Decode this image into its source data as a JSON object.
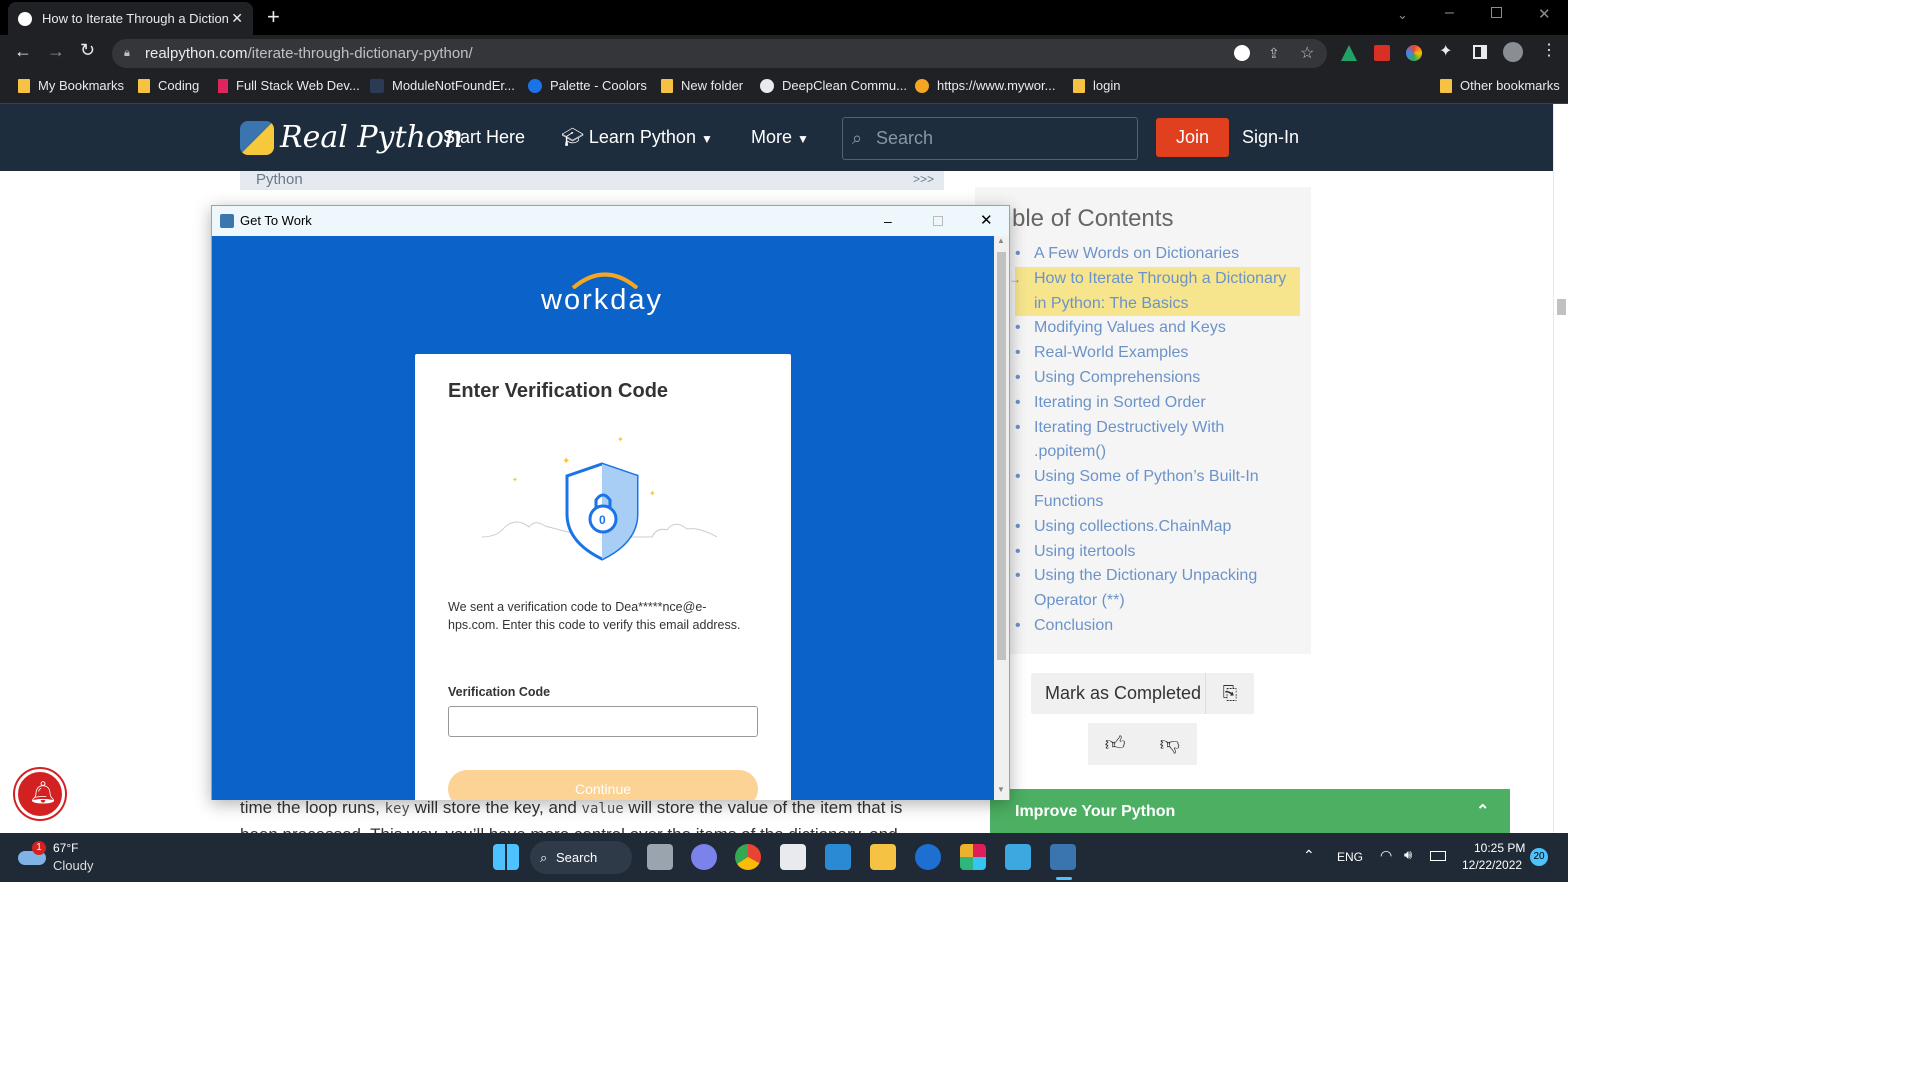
{
  "browser": {
    "tab_title": "How to Iterate Through a Diction",
    "url_host": "realpython.com",
    "url_path": "/iterate-through-dictionary-python/",
    "bookmarks": [
      "My Bookmarks",
      "Coding",
      "Full Stack Web Dev...",
      "ModuleNotFoundEr...",
      "Palette - Coolors",
      "New folder",
      "DeepClean Commu...",
      "https://www.mywor...",
      "login"
    ],
    "other_bookmarks": "Other bookmarks"
  },
  "site": {
    "logo": "Real Python",
    "nav": {
      "start": "Start Here",
      "learn": "Learn Python",
      "more": "More"
    },
    "search_placeholder": "Search",
    "join": "Join",
    "signin": "Sign-In",
    "breadcrumb_bar": "Python",
    "breadcrumb_arrows": ">>>",
    "toc_title": "ble of Contents",
    "toc": [
      "A Few Words on Dictionaries",
      "How to Iterate Through a Dictionary in Python: The Basics",
      "Modifying Values and Keys",
      "Real-World Examples",
      "Using Comprehensions",
      "Iterating in Sorted Order",
      "Iterating Destructively With .popitem()",
      "Using Some of Python’s Built-In Functions",
      "Using collections.ChainMap",
      "Using itertools",
      "Using the Dictionary Unpacking Operator (**)",
      "Conclusion"
    ],
    "mark_completed": "Mark as Completed",
    "improve": "Improve Your Python",
    "body_line1_a": "time the loop runs, ",
    "body_code1": "key",
    "body_line1_b": " will store the key, and ",
    "body_code2": "value",
    "body_line1_c": " will store the value of the item that is",
    "body_line2": "been processed. This way, you’ll have more control over the items of the dictionary, and"
  },
  "dialog": {
    "window_title": "Get To Work",
    "brand": "workday",
    "heading": "Enter Verification Code",
    "message": "We sent a verification code to Dea*****nce@e-hps.com. Enter this code to verify this email address.",
    "code_label": "Verification Code",
    "code_value": "",
    "continue": "Continue"
  },
  "taskbar": {
    "temp": "67°F",
    "weather": "Cloudy",
    "weather_badge": "1",
    "search": "Search",
    "lang": "ENG",
    "time": "10:25 PM",
    "date": "12/22/2022",
    "notif_count": "20"
  },
  "colors": {
    "site_nav": "#1d2d3d",
    "join": "#e0401e",
    "workday_blue": "#0b62c9",
    "continue": "#fcd295",
    "improve": "#4caf62"
  }
}
